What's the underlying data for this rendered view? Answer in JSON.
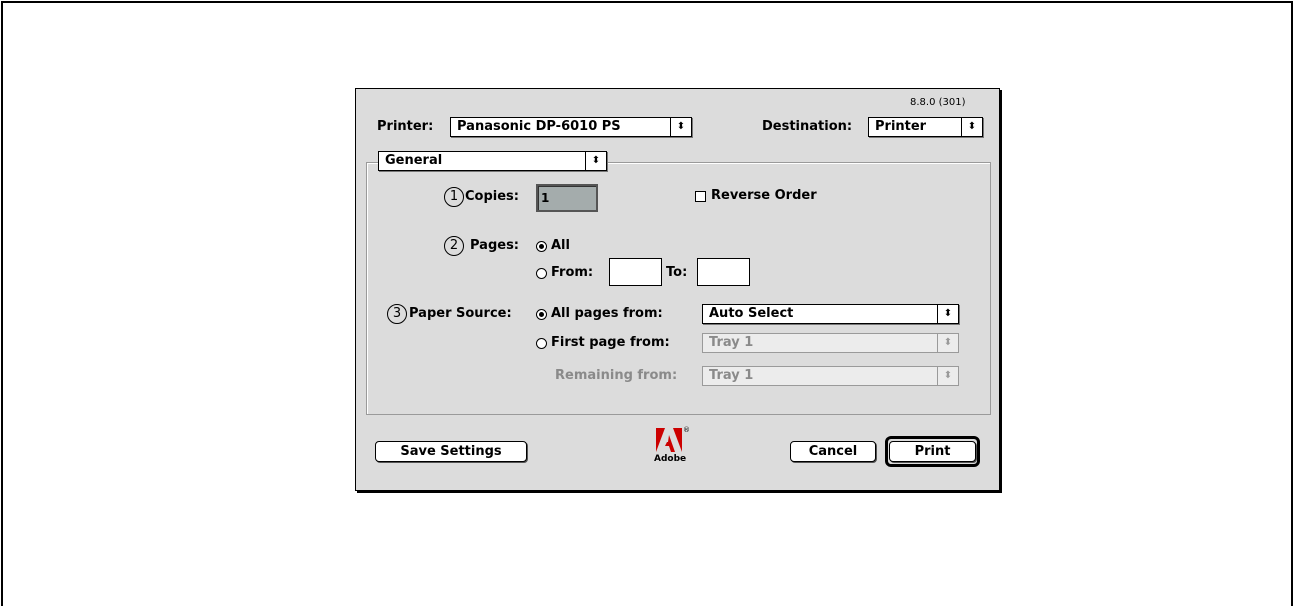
{
  "version": "8.8.0 (301)",
  "printer": {
    "label": "Printer:",
    "value": "Panasonic DP-6010 PS"
  },
  "destination": {
    "label": "Destination:",
    "value": "Printer"
  },
  "panel": {
    "value": "General"
  },
  "copies": {
    "marker": "1",
    "label": "Copies:",
    "value": "1"
  },
  "reverse_order": {
    "label": "Reverse Order",
    "checked": false
  },
  "pages": {
    "marker": "2",
    "label": "Pages:",
    "all_label": "All",
    "from_label": "From:",
    "to_label": "To:",
    "from_value": "",
    "to_value": "",
    "selected": "All"
  },
  "paper_source": {
    "marker": "3",
    "label": "Paper Source:",
    "all_pages_label": "All pages from:",
    "all_pages_value": "Auto Select",
    "first_page_label": "First page from:",
    "first_page_value": "Tray 1",
    "remaining_label": "Remaining from:",
    "remaining_value": "Tray 1",
    "selected": "All pages from:"
  },
  "buttons": {
    "save": "Save Settings",
    "cancel": "Cancel",
    "print": "Print"
  },
  "logo": {
    "name": "adobe-logo",
    "text": "Adobe"
  },
  "icons": {
    "popup_arrows": "up-down-arrows-icon"
  }
}
